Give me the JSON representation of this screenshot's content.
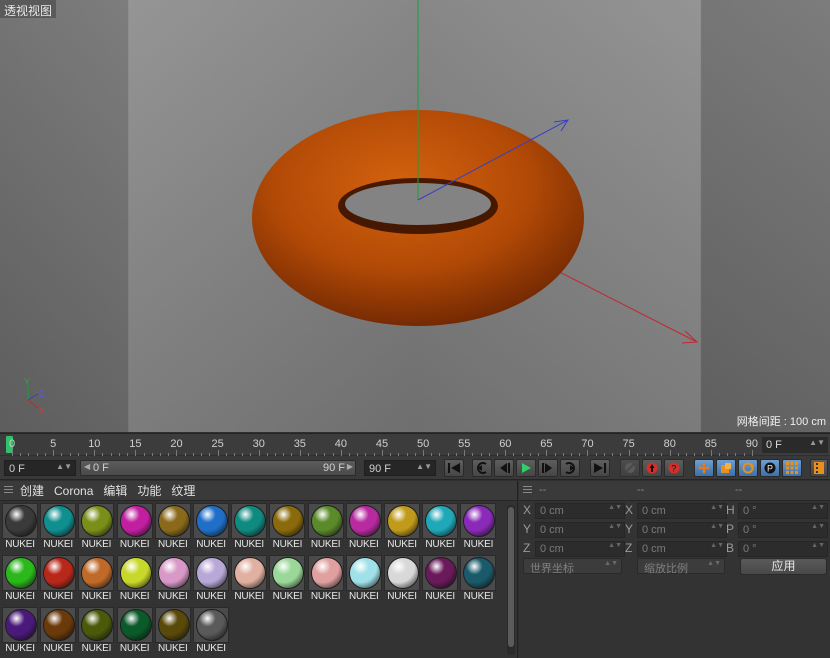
{
  "viewport": {
    "title": "透视视图",
    "grid_spacing": "网格间距 : 100 cm",
    "axis_gizmo": {
      "x": "X",
      "y": "Y",
      "z": "Z"
    },
    "colors": {
      "torus": "#b64a06",
      "axis_x": "#c0282f",
      "axis_y": "#17a33a",
      "axis_z": "#3a3fc0"
    }
  },
  "timeline": {
    "ticks": [
      "0",
      "5",
      "10",
      "15",
      "20",
      "25",
      "30",
      "35",
      "40",
      "45",
      "50",
      "55",
      "60",
      "65",
      "70",
      "75",
      "80",
      "85",
      "90"
    ],
    "current_frame_marker": "0",
    "end_field": "0 F"
  },
  "transport": {
    "start_frame": "0 F",
    "range_start": "0 F",
    "range_end": "90 F",
    "end_frame": "90 F",
    "buttons": [
      "go-to-start",
      "prev-key",
      "prev-frame",
      "play",
      "next-frame",
      "next-key",
      "go-to-end",
      "record-disabled",
      "record-active",
      "auto-key",
      "move-key",
      "scale-key",
      "rotate-key",
      "param-key",
      "pla-key",
      "timeline-view"
    ]
  },
  "materials": {
    "menu": [
      "创建",
      "Corona",
      "编辑",
      "功能",
      "纹理"
    ],
    "items": [
      {
        "label": "NUKEI",
        "color": "#3a3a3a"
      },
      {
        "label": "NUKEI",
        "color": "#0f8f8f"
      },
      {
        "label": "NUKEI",
        "color": "#7a8f1a"
      },
      {
        "label": "NUKEI",
        "color": "#c21fa0"
      },
      {
        "label": "NUKEI",
        "color": "#8a6a1a"
      },
      {
        "label": "NUKEI",
        "color": "#1f6fc8"
      },
      {
        "label": "NUKEI",
        "color": "#0f8a80"
      },
      {
        "label": "NUKEI",
        "color": "#8a6a0a"
      },
      {
        "label": "NUKEI",
        "color": "#5a8a2a"
      },
      {
        "label": "NUKEI",
        "color": "#b82aa0"
      },
      {
        "label": "NUKEI",
        "color": "#c09a1a"
      },
      {
        "label": "NUKEI",
        "color": "#1fa8b8"
      },
      {
        "label": "NUKEI",
        "color": "#8a2ab8"
      },
      {
        "label": "NUKEI",
        "color": "#2ab81a"
      },
      {
        "label": "NUKEI",
        "color": "#b8281a"
      },
      {
        "label": "NUKEI",
        "color": "#c06a2a"
      },
      {
        "label": "NUKEI",
        "color": "#c8d82a"
      },
      {
        "label": "NUKEI",
        "color": "#d898c8"
      },
      {
        "label": "NUKEI",
        "color": "#b8a8d8"
      },
      {
        "label": "NUKEI",
        "color": "#e0b0a0"
      },
      {
        "label": "NUKEI",
        "color": "#9ad89a"
      },
      {
        "label": "NUKEI",
        "color": "#e0a0a0"
      },
      {
        "label": "NUKEI",
        "color": "#a0e0e8"
      },
      {
        "label": "NUKEI",
        "color": "#d8d8d8"
      },
      {
        "label": "NUKEI",
        "color": "#6a1a5a"
      },
      {
        "label": "NUKEI",
        "color": "#1a5a6a"
      },
      {
        "label": "NUKEI",
        "color": "#4a1a7a"
      },
      {
        "label": "NUKEI",
        "color": "#6a3a0a"
      },
      {
        "label": "NUKEI",
        "color": "#4a5a0a"
      },
      {
        "label": "NUKEI",
        "color": "#0a5a2a"
      },
      {
        "label": "NUKEI",
        "color": "#5a4a0a"
      },
      {
        "label": "NUKEI",
        "color": "#5a5a5a"
      }
    ]
  },
  "coordinates": {
    "headers": [
      "--",
      "--",
      "--"
    ],
    "rows": [
      {
        "a1": "X",
        "v1": "0 cm",
        "a2": "X",
        "v2": "0 cm",
        "a3": "H",
        "v3": "0 °"
      },
      {
        "a1": "Y",
        "v1": "0 cm",
        "a2": "Y",
        "v2": "0 cm",
        "a3": "P",
        "v3": "0 °"
      },
      {
        "a1": "Z",
        "v1": "0 cm",
        "a2": "Z",
        "v2": "0 cm",
        "a3": "B",
        "v3": "0 °"
      }
    ],
    "mode_dropdown": "世界坐标",
    "scale_dropdown": "缩放比例",
    "apply_label": "应用"
  }
}
